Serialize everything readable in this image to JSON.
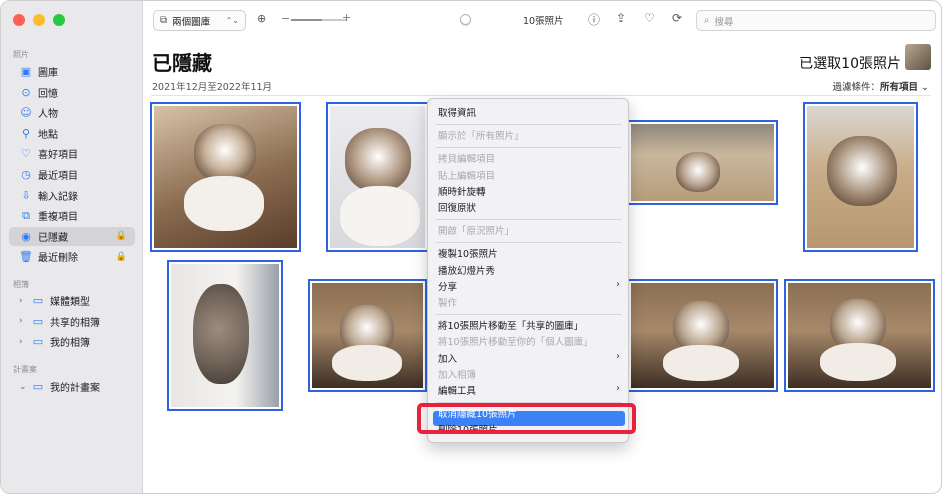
{
  "window": {
    "traffic_colors": [
      "#fe5f57",
      "#febc2e",
      "#28c840"
    ]
  },
  "sidebar": {
    "section_photos": "照片",
    "items": [
      {
        "label": "圖庫",
        "icon": "library-icon",
        "glyph": "▣"
      },
      {
        "label": "回憶",
        "icon": "memories-icon",
        "glyph": "⊙"
      },
      {
        "label": "人物",
        "icon": "people-icon",
        "glyph": "☺"
      },
      {
        "label": "地點",
        "icon": "places-icon",
        "glyph": "⚲"
      },
      {
        "label": "喜好項目",
        "icon": "heart-icon",
        "glyph": "♡"
      },
      {
        "label": "最近項目",
        "icon": "clock-icon",
        "glyph": "◷"
      },
      {
        "label": "輸入記錄",
        "icon": "import-icon",
        "glyph": "⇩"
      },
      {
        "label": "重複項目",
        "icon": "duplicates-icon",
        "glyph": "⧉"
      },
      {
        "label": "已隱藏",
        "icon": "eye-icon",
        "glyph": "◉",
        "selected": true,
        "locked": true
      },
      {
        "label": "最近刪除",
        "icon": "trash-icon",
        "glyph": "🗑",
        "locked": true
      }
    ],
    "section_albums": "相簿",
    "albums": [
      {
        "label": "媒體類型",
        "icon": "folder-icon",
        "glyph": "▭"
      },
      {
        "label": "共享的相簿",
        "icon": "shared-folder-icon",
        "glyph": "▭"
      },
      {
        "label": "我的相簿",
        "icon": "folder-icon",
        "glyph": "▭"
      }
    ],
    "section_projects": "計畫案",
    "projects": [
      {
        "label": "我的計畫案",
        "icon": "folder-icon",
        "glyph": "▭"
      }
    ]
  },
  "toolbar": {
    "library_select": "兩個圖庫",
    "zoom_fraction": 0.55,
    "count_label": "10張照片",
    "search_placeholder": "搜尋"
  },
  "main": {
    "title": "已隱藏",
    "date_range": "2021年12月至2022年11月",
    "selected_label": "已選取10張照片",
    "filter_label": "過濾條件：",
    "filter_value": "所有項目"
  },
  "context_menu": {
    "items": [
      {
        "label": "取得資訊",
        "disabled": false
      },
      {
        "sep": true
      },
      {
        "label": "顯示於「所有照片」",
        "disabled": true
      },
      {
        "sep": true
      },
      {
        "label": "拷貝編輯項目",
        "disabled": true
      },
      {
        "label": "貼上編輯項目",
        "disabled": true
      },
      {
        "label": "順時針旋轉",
        "disabled": false
      },
      {
        "label": "回復原狀",
        "disabled": false
      },
      {
        "sep": true
      },
      {
        "label": "開啟「原況照片」",
        "disabled": true
      },
      {
        "sep": true
      },
      {
        "label": "複製10張照片",
        "disabled": false
      },
      {
        "label": "播放幻燈片秀",
        "disabled": false
      },
      {
        "label": "分享",
        "disabled": false,
        "submenu": true
      },
      {
        "label": "製作",
        "disabled": true
      },
      {
        "sep": true
      },
      {
        "label": "將10張照片移動至「共享的圖庫」",
        "disabled": false
      },
      {
        "label": "將10張照片移動至你的「個人圖庫」",
        "disabled": true
      },
      {
        "label": "加入",
        "disabled": false,
        "submenu": true
      },
      {
        "label": "加入相簿",
        "disabled": true
      },
      {
        "label": "編輯工具",
        "disabled": false,
        "submenu": true
      },
      {
        "sep": true
      },
      {
        "label": "取消隱藏10張照片",
        "disabled": false,
        "highlighted": true
      },
      {
        "label": "刪除10張照片",
        "disabled": false
      }
    ],
    "highlight_color": "#3b82f7",
    "annotation_color": "#e8213d"
  },
  "colors": {
    "selection_border": "#2d62e0",
    "accent": "#2f7bf5"
  }
}
